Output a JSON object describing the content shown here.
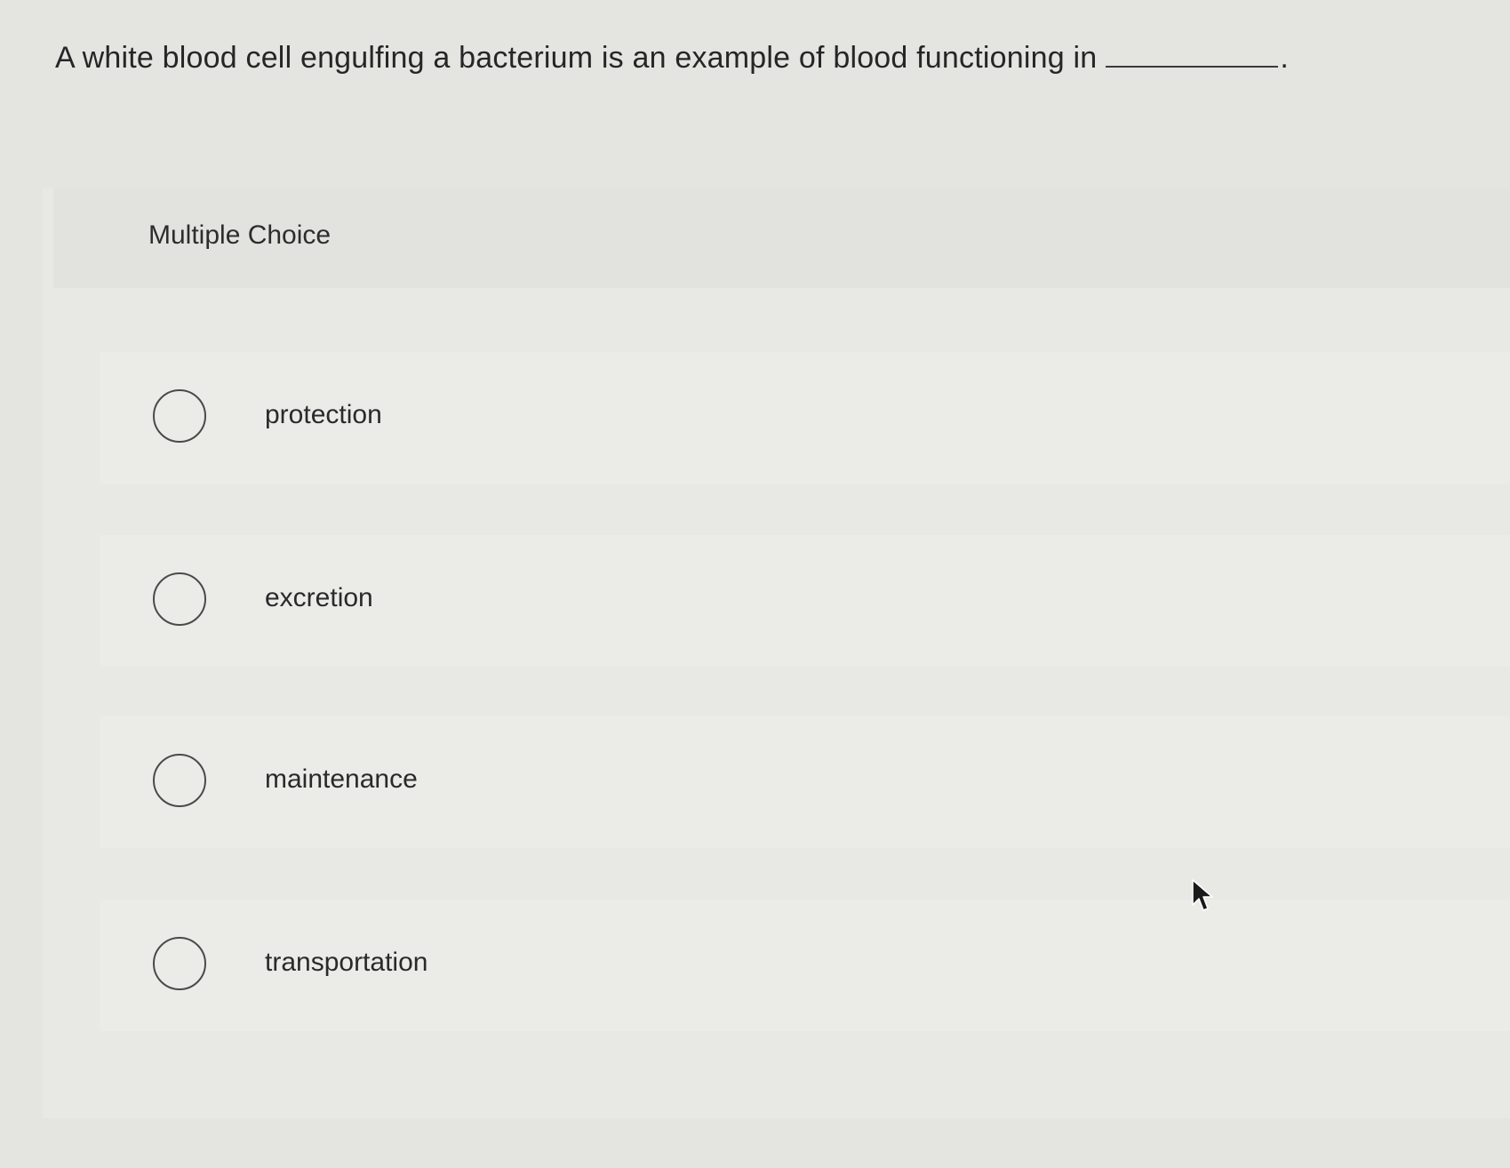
{
  "question": {
    "text": "A white blood cell engulfing a bacterium is an example of blood functioning in",
    "period": "."
  },
  "multiple_choice": {
    "header": "Multiple Choice",
    "options": [
      {
        "label": "protection",
        "selected": false
      },
      {
        "label": "excretion",
        "selected": false
      },
      {
        "label": "maintenance",
        "selected": false
      },
      {
        "label": "transportation",
        "selected": false
      }
    ]
  },
  "icons": {
    "radio": "radio-unchecked-icon",
    "cursor": "mouse-pointer-icon"
  }
}
